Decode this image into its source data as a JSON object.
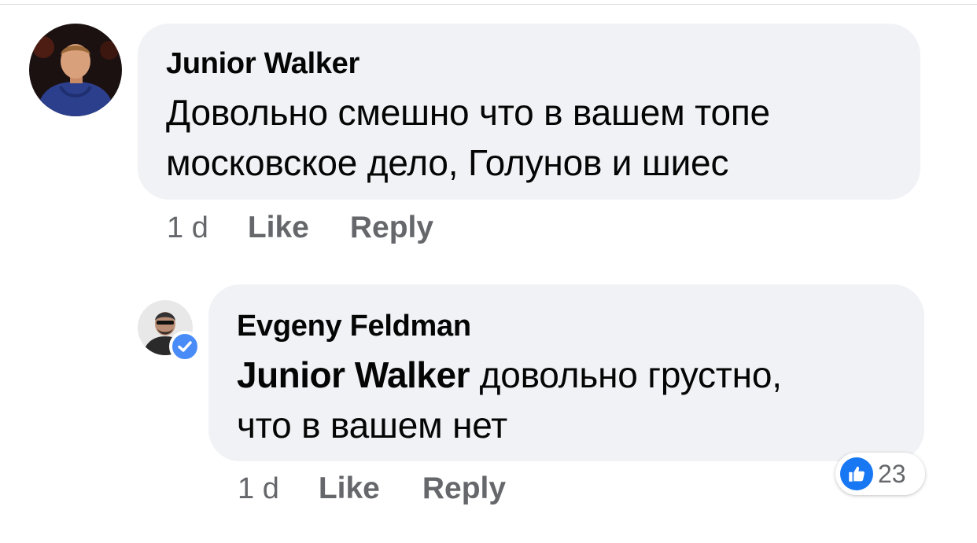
{
  "comments": [
    {
      "author": "Junior  Walker",
      "text_lines": [
        "Довольно смешно что в вашем топе",
        "московское дело, Голунов и шиес"
      ],
      "time": "1 d",
      "like_label": "Like",
      "reply_label": "Reply"
    }
  ],
  "reply": {
    "author": "Evgeny Feldman",
    "mention": "Junior  Walker",
    "text_after_mention": " довольно грустно,",
    "text_line2": "что в вашем нет",
    "time": "1 d",
    "like_label": "Like",
    "reply_label": "Reply",
    "reaction_count": "23",
    "verified": true
  },
  "colors": {
    "bubble": "#f0f2f5",
    "meta_text": "#65676b",
    "like_blue": "#1877f2",
    "verified_blue": "#4a8cf7"
  }
}
